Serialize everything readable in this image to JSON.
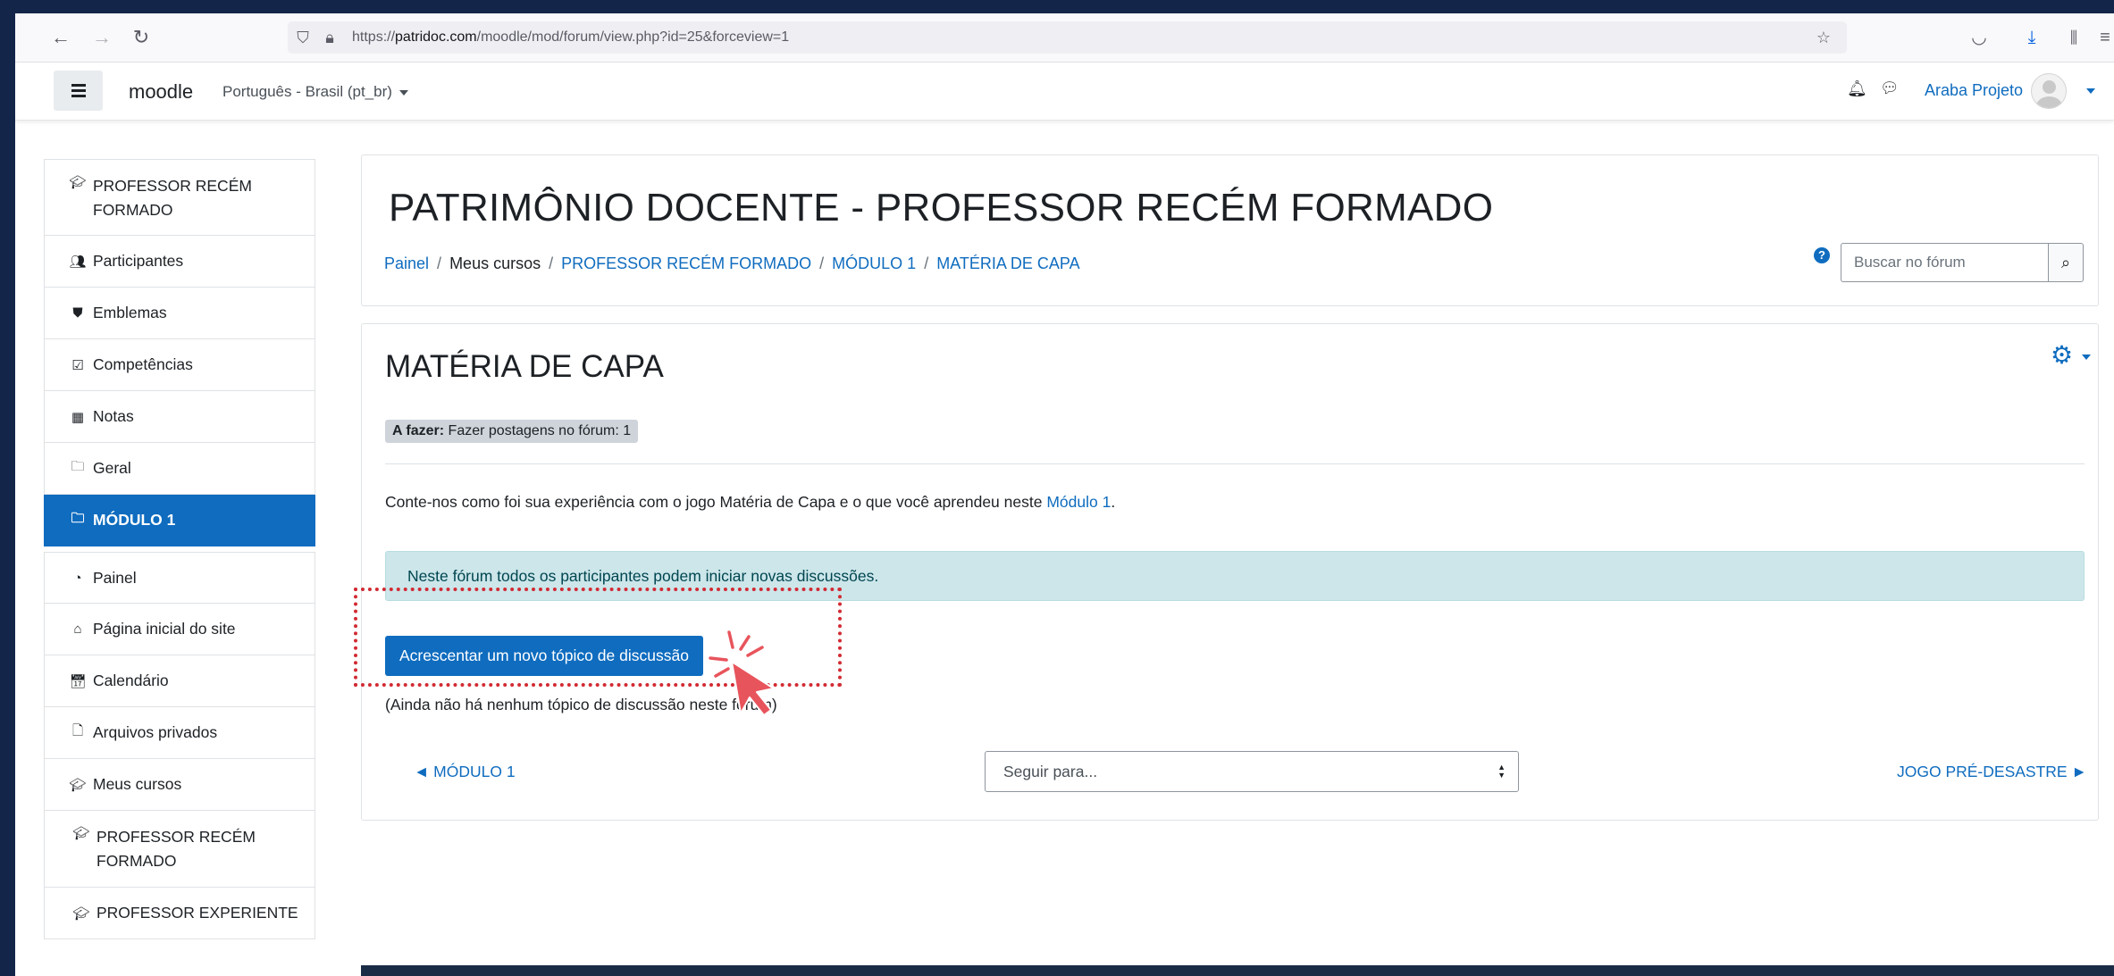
{
  "browser": {
    "url_prefix": "https://",
    "url_domain": "patridoc.com",
    "url_path": "/moodle/mod/forum/view.php?id=25&forceview=1"
  },
  "navbar": {
    "brand": "moodle",
    "language": "Português - Brasil (pt_br)",
    "username": "Araba Projeto"
  },
  "drawer": {
    "items": [
      {
        "label": "PROFESSOR RECÉM FORMADO",
        "icon": "graduation-cap-icon"
      },
      {
        "label": "Participantes",
        "icon": "users-icon"
      },
      {
        "label": "Emblemas",
        "icon": "shield-icon"
      },
      {
        "label": "Competências",
        "icon": "checkbox-icon"
      },
      {
        "label": "Notas",
        "icon": "table-icon"
      },
      {
        "label": "Geral",
        "icon": "folder-icon"
      },
      {
        "label": "MÓDULO 1",
        "icon": "folder-icon"
      },
      {
        "label": "Painel",
        "icon": "dashboard-icon"
      },
      {
        "label": "Página inicial do site",
        "icon": "home-icon"
      },
      {
        "label": "Calendário",
        "icon": "calendar-icon"
      },
      {
        "label": "Arquivos privados",
        "icon": "file-icon"
      },
      {
        "label": "Meus cursos",
        "icon": "graduation-cap-icon"
      },
      {
        "label": "PROFESSOR RECÉM FORMADO",
        "icon": "graduation-cap-icon"
      },
      {
        "label": "PROFESSOR EXPERIENTE",
        "icon": "graduation-cap-icon"
      }
    ]
  },
  "header": {
    "title": "PATRIMÔNIO DOCENTE - PROFESSOR RECÉM FORMADO",
    "breadcrumb": [
      "Painel",
      "Meus cursos",
      "PROFESSOR RECÉM FORMADO",
      "MÓDULO 1",
      "MATÉRIA DE CAPA"
    ],
    "search_placeholder": "Buscar no fórum"
  },
  "forum": {
    "title": "MATÉRIA DE CAPA",
    "todo_label": "A fazer:",
    "todo_text": "Fazer postagens no fórum: 1",
    "intro_text": "Conte-nos como foi sua experiência com o jogo Matéria de Capa e o que você aprendeu neste ",
    "intro_link": "Módulo 1",
    "intro_end": ".",
    "info_alert": "Neste fórum todos os participantes podem iniciar novas discussões.",
    "add_button": "Acrescentar um novo tópico de discussão",
    "empty_note": "(Ainda não há nenhum tópico de discussão neste fórum)",
    "prev_link": "◄ MÓDULO 1",
    "jump_select": "Seguir para...",
    "next_link": "JOGO PRÉ-DESASTRE ►"
  },
  "colors": {
    "primary": "#0f6cbf",
    "info_bg": "#cce6ea",
    "highlight": "#d22a33",
    "frame": "#13264a"
  }
}
